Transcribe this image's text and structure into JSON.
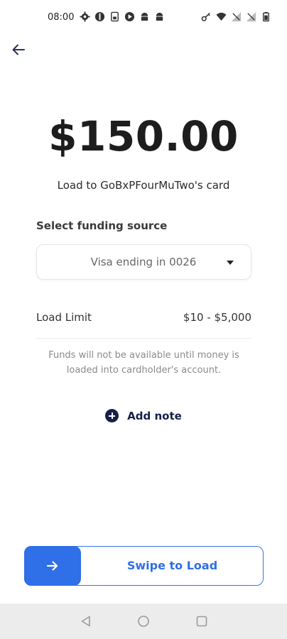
{
  "status_bar": {
    "time": "08:00",
    "left_icons": [
      "settings-icon",
      "circle-app-icon",
      "sim-icon",
      "play-icon",
      "android-icon",
      "android-icon"
    ],
    "right_icons": [
      "key-icon",
      "wifi-icon",
      "no-signal-icon",
      "no-signal-icon",
      "battery-icon"
    ]
  },
  "header": {
    "back_icon": "arrow-left-icon"
  },
  "amount": "$150.00",
  "load_to": "Load to GoBxPFourMuTwo's card",
  "funding": {
    "label": "Select funding source",
    "selected": "Visa ending in 0026"
  },
  "load_limit": {
    "label": "Load Limit",
    "value": "$10 - $5,000"
  },
  "notice": "Funds will not be available until money is loaded into cardholder's account.",
  "add_note": {
    "label": "Add note"
  },
  "swipe": {
    "label": "Swipe to Load"
  },
  "colors": {
    "accent": "#2f6fe8",
    "navy": "#15204a",
    "text": "#1d1d1d"
  },
  "nav": {
    "back": "triangle-back-icon",
    "home": "circle-home-icon",
    "recents": "square-recents-icon"
  }
}
